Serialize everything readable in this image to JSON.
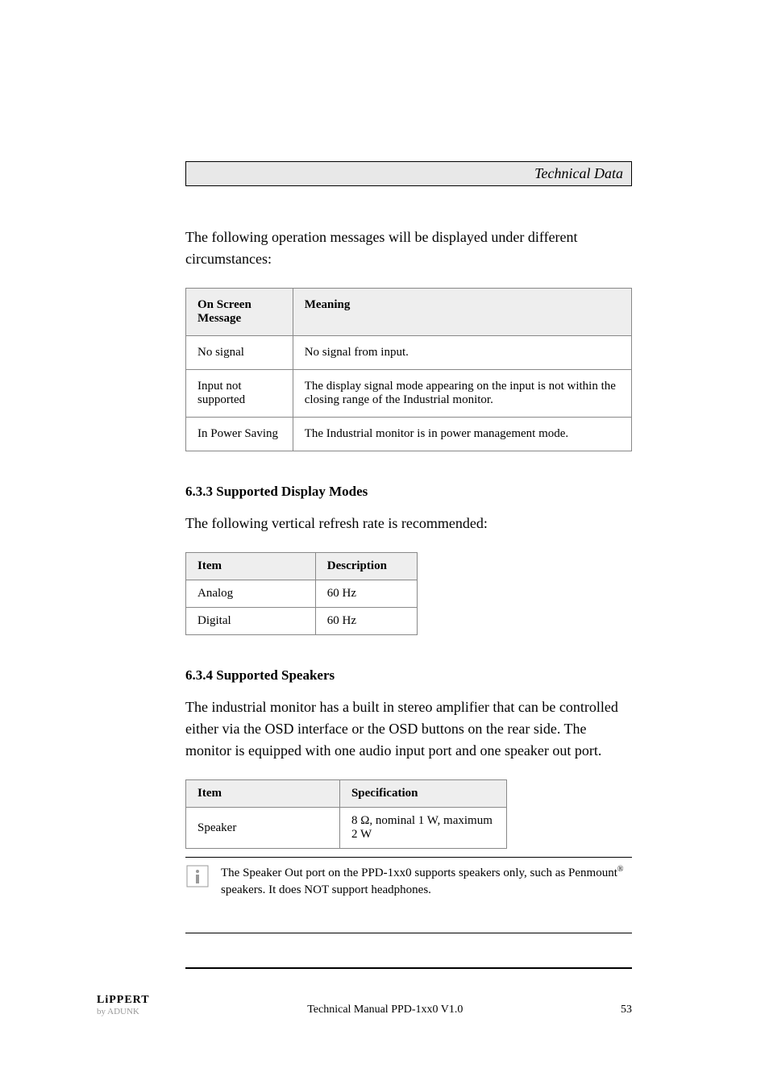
{
  "header": {
    "title": "Technical Data"
  },
  "intro1": "The following operation messages will be displayed under different circumstances:",
  "msg_table": {
    "head": {
      "col1": "On Screen Message",
      "col2": "Meaning"
    },
    "rows": [
      {
        "c1": "No signal",
        "c2": "No signal from input."
      },
      {
        "c1": "Input not supported",
        "c2": "The display signal mode appearing on the input is not within the closing range of the Industrial monitor."
      },
      {
        "c1": "In Power Saving",
        "c2": "The Industrial monitor is in power management mode."
      }
    ]
  },
  "section2": {
    "heading": "6.3.3 Supported Display Modes",
    "intro": "The following vertical refresh rate is recommended:"
  },
  "rate_table": {
    "head": {
      "col1": "Item",
      "col2": "Description"
    },
    "rows": [
      {
        "c1": "Analog",
        "c2": "60 Hz"
      },
      {
        "c1": "Digital",
        "c2": "60 Hz"
      }
    ]
  },
  "section3": {
    "heading": "6.3.4 Supported Speakers",
    "intro": "The industrial monitor has a built in stereo amplifier that can be controlled either via the OSD interface or the OSD buttons on the rear side. The monitor is equipped with one audio input port and one speaker out port."
  },
  "spk_table": {
    "head": {
      "col1": "Item",
      "col2": "Specification"
    },
    "rows": [
      {
        "c1": "Speaker",
        "c2": "8 Ω, nominal 1 W, maximum 2 W"
      }
    ]
  },
  "note": {
    "text_prefix": "The Speaker Out port on the PPD-1xx0 supports speakers only, such as Penmount",
    "text_sup": "®",
    "text_suffix": " speakers. It does NOT support headphones."
  },
  "footer": {
    "logo": "LiPPERT",
    "sub": "by ADUNK",
    "doc": "Technical Manual PPD-1xx0 V1.0",
    "page": "53"
  }
}
